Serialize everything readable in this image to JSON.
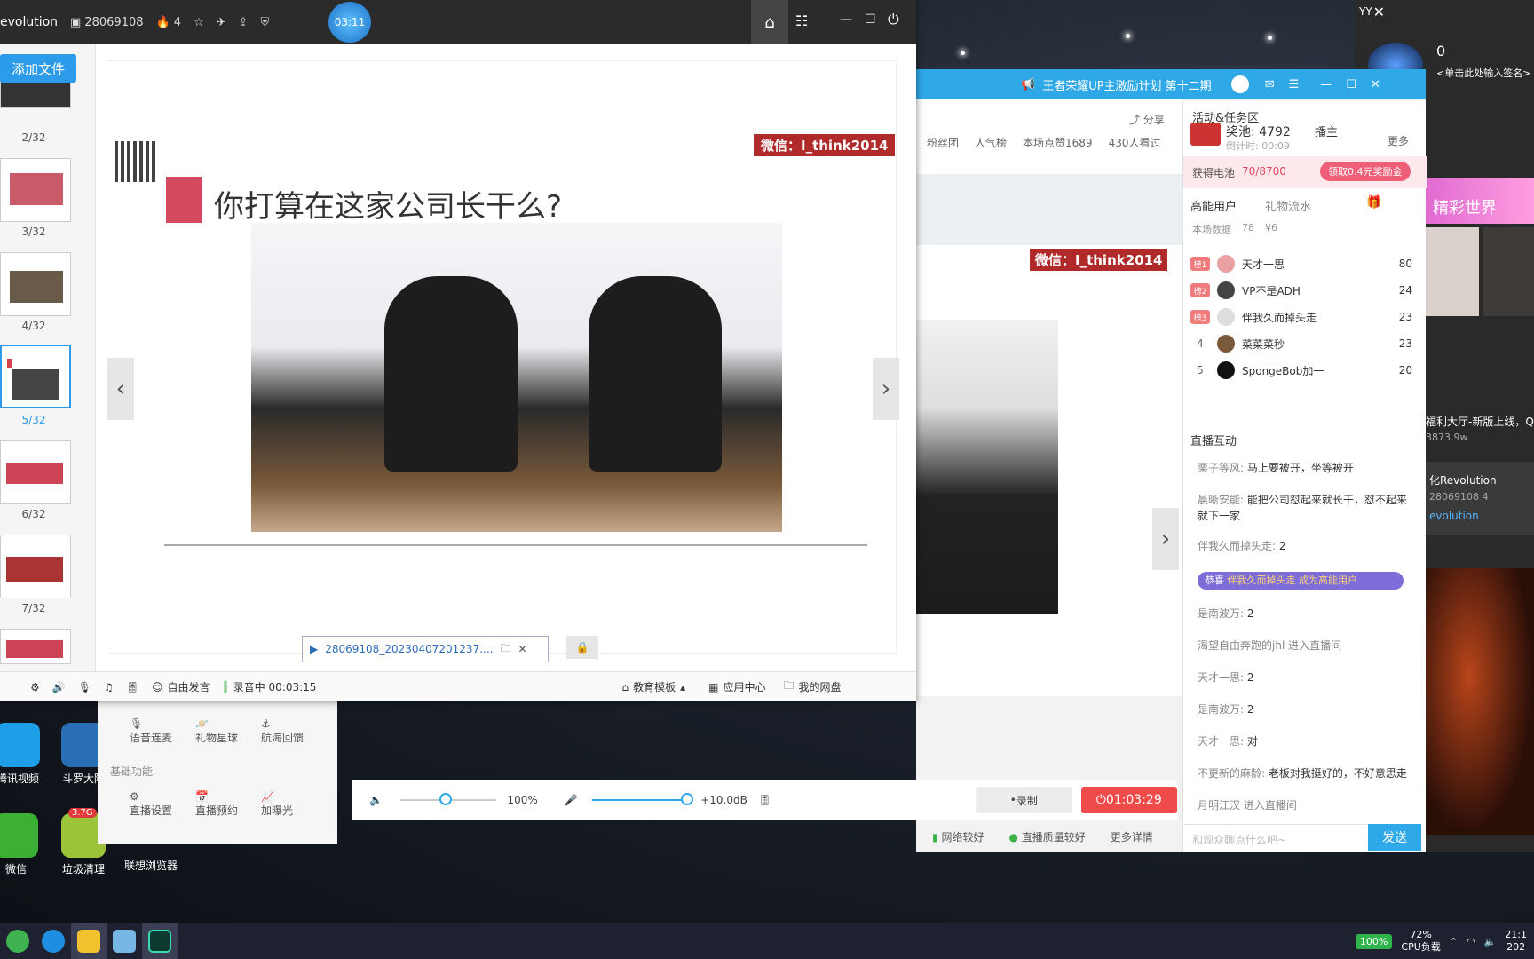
{
  "ppt": {
    "title_partial": "evolution",
    "room_id": "28069108",
    "likes": "4",
    "timer": "03:11",
    "add_file": "添加文件",
    "thumbs": [
      "2/32",
      "3/32",
      "4/32",
      "5/32",
      "6/32",
      "7/32"
    ],
    "slide": {
      "wechat": "微信：I_think2014",
      "title": "你打算在这家公司长干么?"
    },
    "file_chip": "28069108_20230407201237....",
    "bottom": {
      "free_speech": "自由发言",
      "recording": "录音中 00:03:15",
      "edu_template": "教育模板",
      "app_center": "应用中心",
      "my_disk": "我的网盘"
    }
  },
  "live": {
    "title": "王者荣耀UP主激励计划 第十二期",
    "share": "分享",
    "fans": "粉丝团",
    "popular": "人气榜",
    "likes_stat": "本场点赞1689",
    "viewers": "430人看过",
    "wechat2": "微信：I_think2014",
    "tools": {
      "voice_link": "语音连麦",
      "gift_planet": "礼物星球",
      "voyage": "航海回馈",
      "basic": "基础功能",
      "settings": "直播设置",
      "schedule": "直播预约",
      "boost": "加曝光"
    },
    "volume": "100%",
    "mic_gain": "+10.0dB",
    "record": "录制",
    "live_time": "01:03:29",
    "net_ok": "网络较好",
    "quality_ok": "直播质量较好",
    "more_detail": "更多详情",
    "activity": "活动&任务区",
    "prize_pool": "奖池: 4792",
    "host": "播主",
    "countdown": "倒计时: 00:09",
    "more": "更多",
    "battery_label": "获得电池",
    "battery_val": "70/8700",
    "battery_btn": "领取0.4元奖励金",
    "tab_high": "高能用户",
    "tab_gift": "礼物流水",
    "stats_label": "本场数据",
    "stats_people": "78",
    "stats_money": "¥6",
    "users": [
      {
        "rank": "榜1",
        "name": "天才一思",
        "score": "80"
      },
      {
        "rank": "榜2",
        "name": "VP不是ADH",
        "score": "24"
      },
      {
        "rank": "榜3",
        "name": "伴我久而掉头走",
        "score": "23"
      },
      {
        "rank": "4",
        "name": "菜菜菜秒",
        "score": "23"
      },
      {
        "rank": "5",
        "name": "SpongeBob加一",
        "score": "20"
      }
    ],
    "interact": "直播互动",
    "chats": [
      {
        "name": "栗子等风:",
        "text": "马上要被开，坐等被开"
      },
      {
        "name": "晨晰安能:",
        "text": "能把公司怼起来就长干，怼不起来就下一家"
      },
      {
        "name": "伴我久而掉头走:",
        "text": "2"
      },
      {
        "name": "恭喜",
        "text": "伴我久而掉头走 成为高能用户"
      },
      {
        "name": "是南波万:",
        "text": "2"
      },
      {
        "name": "渴望自由奔跑的jhl",
        "text": "进入直播间"
      },
      {
        "name": "天才一思:",
        "text": "2"
      },
      {
        "name": "是南波万:",
        "text": "2"
      },
      {
        "name": "天才一思:",
        "text": "对"
      },
      {
        "name": "不更新的麻龄:",
        "text": "老板对我挺好的，不好意思走"
      },
      {
        "name": "月明江汉",
        "text": "进入直播间"
      }
    ],
    "input_placeholder": "和观众聊点什么吧~",
    "send": "发送"
  },
  "desktop": {
    "icons": [
      "腾讯视频",
      "斗罗大陆",
      "微信",
      "垃圾清理",
      "联想浏览器"
    ],
    "cleaner_badge": "3.7G"
  },
  "yy": {
    "label": "YY",
    "zero": "0",
    "sign": "<单击此处输入签名>",
    "world": "精彩世界",
    "news": "福利大厅-新版上线，Q",
    "count": "3873.9w",
    "channel": "化Revolution",
    "channel_id": "28069108",
    "channel_n": "4",
    "link": "evolution"
  },
  "taskbar": {
    "battery": "100%",
    "cpu": "72%",
    "cpu_label": "CPU负载",
    "time": "21:1",
    "date": "202"
  }
}
